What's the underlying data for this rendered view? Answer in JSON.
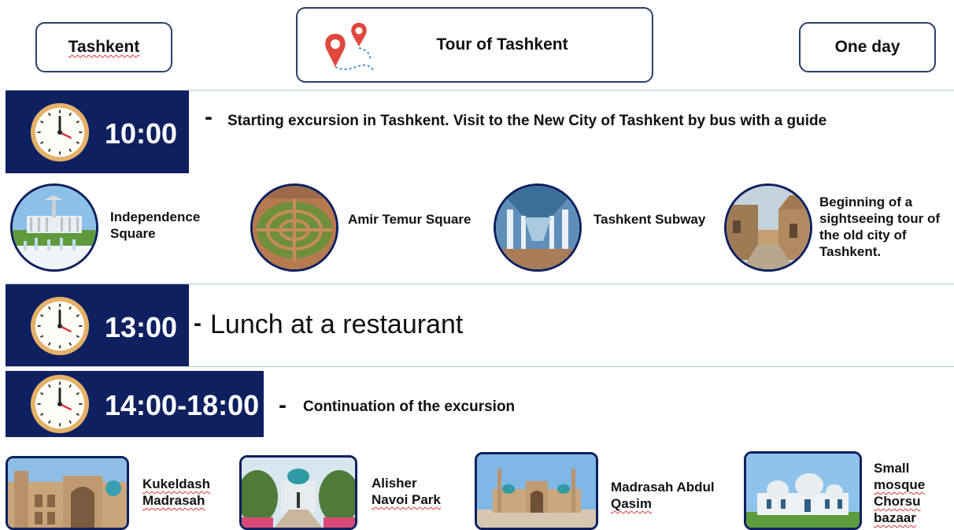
{
  "header": {
    "city": "Tashkent",
    "title": "Tour of Tashkent",
    "duration": "One day"
  },
  "schedule": [
    {
      "time": "10:00",
      "dash": "-",
      "text": "Starting excursion in Tashkent. Visit to the New City of Tashkent by bus with a guide"
    },
    {
      "time": "13:00",
      "dash": "-",
      "text": "Lunch at a restaurant"
    },
    {
      "time": "14:00-18:00",
      "dash": "-",
      "text": "Continuation of the excursion"
    }
  ],
  "morning_sights": [
    {
      "label_lines": [
        "Independence",
        "Square"
      ]
    },
    {
      "label_lines": [
        "Amir Temur Square"
      ]
    },
    {
      "label_lines": [
        "Tashkent Subway"
      ]
    },
    {
      "label_lines": [
        "Beginning of a",
        "sightseeing tour of",
        "the old city of",
        "Tashkent."
      ]
    }
  ],
  "afternoon_sights": [
    {
      "label_lines": [
        "Kukeldash",
        "Madrasah"
      ]
    },
    {
      "label_lines": [
        "Alisher",
        "Navoi Park"
      ]
    },
    {
      "label_lines": [
        "Madrasah Abdul",
        "Qasim"
      ]
    },
    {
      "label_lines": [
        "Small",
        "mosque",
        "Chorsu",
        "bazaar"
      ]
    }
  ],
  "colors": {
    "navy": "#0e2060",
    "pin": "#e0483d",
    "clock_face": "#fdfcf7",
    "clock_rim": "#e3b169"
  },
  "icons": [
    "map-route-icon",
    "clock-icon"
  ]
}
